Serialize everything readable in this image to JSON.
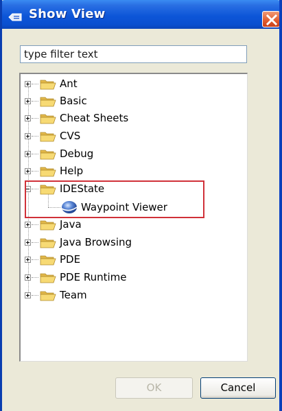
{
  "window": {
    "title": "Show View"
  },
  "filter": {
    "placeholder": "type filter text"
  },
  "tree": {
    "items": [
      {
        "label": "Ant",
        "expanded": false
      },
      {
        "label": "Basic",
        "expanded": false
      },
      {
        "label": "Cheat Sheets",
        "expanded": false
      },
      {
        "label": "CVS",
        "expanded": false
      },
      {
        "label": "Debug",
        "expanded": false
      },
      {
        "label": "Help",
        "expanded": false
      },
      {
        "label": "IDEState",
        "expanded": true,
        "children": [
          {
            "label": "Waypoint Viewer"
          }
        ]
      },
      {
        "label": "Java",
        "expanded": false
      },
      {
        "label": "Java Browsing",
        "expanded": false
      },
      {
        "label": "PDE",
        "expanded": false
      },
      {
        "label": "PDE Runtime",
        "expanded": false
      },
      {
        "label": "Team",
        "expanded": false
      }
    ]
  },
  "buttons": {
    "ok": "OK",
    "cancel": "Cancel"
  },
  "colors": {
    "titlebar": "#0a4fd0",
    "highlight": "#d03038",
    "folder": "#f5d36a"
  }
}
